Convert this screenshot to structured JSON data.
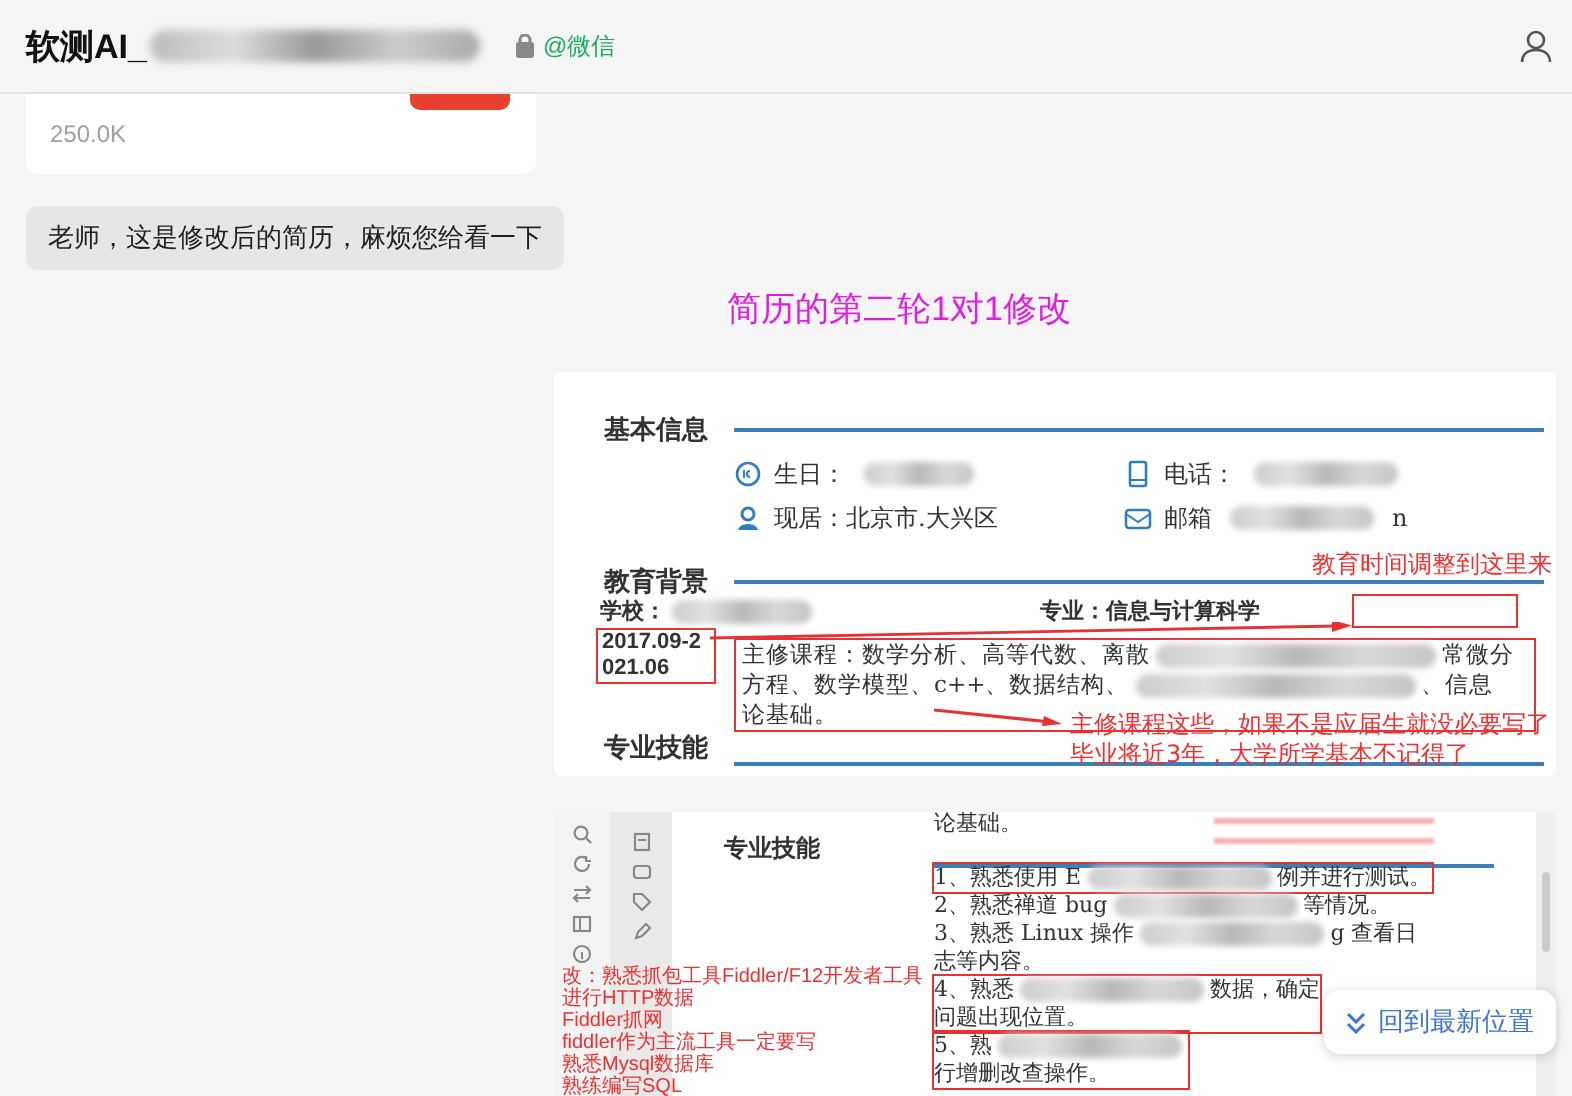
{
  "header": {
    "title": "软测AI_",
    "source": "@微信"
  },
  "messages": [
    {
      "kind": "file",
      "size": "250.0K"
    },
    {
      "kind": "text",
      "text": "老师，这是修改后的简历，麻烦您给看一下"
    },
    {
      "kind": "note",
      "text": "简历的第二轮1对1修改"
    },
    {
      "kind": "resume_image",
      "basic": {
        "heading": "基本信息",
        "fields": [
          {
            "label": "生日：",
            "redacted": true
          },
          {
            "label": "电话：",
            "redacted": true
          },
          {
            "label": "现居：北京市.大兴区",
            "redacted": false
          },
          {
            "label": "邮箱",
            "redacted": true,
            "tail": "n"
          }
        ]
      },
      "education": {
        "heading": "教育背景",
        "school": "学校：",
        "major": "专业：信息与计算科学",
        "dates": [
          "2017.09-2",
          "021.06"
        ],
        "courses": [
          {
            "start": "主修课程：数学分析、高等代数、离散",
            "redacted": true,
            "end": "常微分"
          },
          {
            "start": "方程、数学模型、c++、数据结构、",
            "redacted": true,
            "end": "、信息"
          },
          {
            "start": "论基础。",
            "redacted": false
          }
        ]
      },
      "annotations": [
        "教育时间调整到这里来",
        "主修课程这些，如果不是应届生就没必要写了",
        "毕业将近3年，大学所学基本不记得了"
      ],
      "next_heading": "专业技能"
    },
    {
      "kind": "doc_image",
      "first_line": "论基础。",
      "heading": "专业技能",
      "items": [
        {
          "boxed": true,
          "lines": [
            {
              "start": "1、熟悉使用 E",
              "redacted": true,
              "end": "例并进行测试。"
            }
          ]
        },
        {
          "boxed": false,
          "lines": [
            {
              "start": "2、熟悉禅道 bug",
              "redacted": true,
              "end": "等情况。"
            }
          ]
        },
        {
          "boxed": false,
          "lines": [
            {
              "start": "3、熟悉 Linux 操作",
              "redacted": true,
              "end": "g 查看日"
            },
            {
              "start": "志等内容。",
              "redacted": false
            }
          ]
        },
        {
          "boxed": true,
          "lines": [
            {
              "start": "4、熟悉",
              "redacted": true,
              "end": "数据，确定"
            },
            {
              "start": "问题出现位置。",
              "redacted": false
            }
          ]
        },
        {
          "boxed": true,
          "lines": [
            {
              "start": "5、熟",
              "redacted": true
            },
            {
              "start": "行增删改查操作。",
              "redacted": false
            }
          ]
        }
      ],
      "notes": [
        "改：熟悉抓包工具Fiddler/F12开发者工具",
        "进行HTTP数据",
        "Fiddler抓网",
        "fiddler作为主流工具一定要写",
        "熟悉Mysql数据库",
        "熟练编写SQL"
      ]
    }
  ],
  "jump_button": "回到最新位置"
}
